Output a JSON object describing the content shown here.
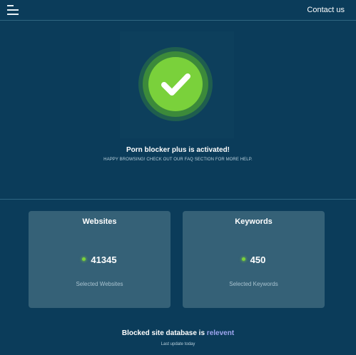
{
  "header": {
    "menu_icon": "hamburger-menu-icon",
    "contact_label": "Contact us"
  },
  "status": {
    "icon": "checkmark-icon",
    "title": "Porn blocker plus is activated!",
    "subtitle": "HAPPY BROWSING! CHECK OUT OUR FAQ SECTION FOR MORE HELP."
  },
  "cards": [
    {
      "title": "Websites",
      "value": "41345",
      "caption": "Selected Websites"
    },
    {
      "title": "Keywords",
      "value": "450",
      "caption": "Selected Keywords"
    }
  ],
  "database": {
    "prefix": "Blocked site database is ",
    "status": "relevent",
    "last_update": "Last update today"
  },
  "colors": {
    "background": "#0b3c5a",
    "card": "#356177",
    "success_green": "#7ad13b",
    "accent_lavender": "#9fa6f0"
  }
}
